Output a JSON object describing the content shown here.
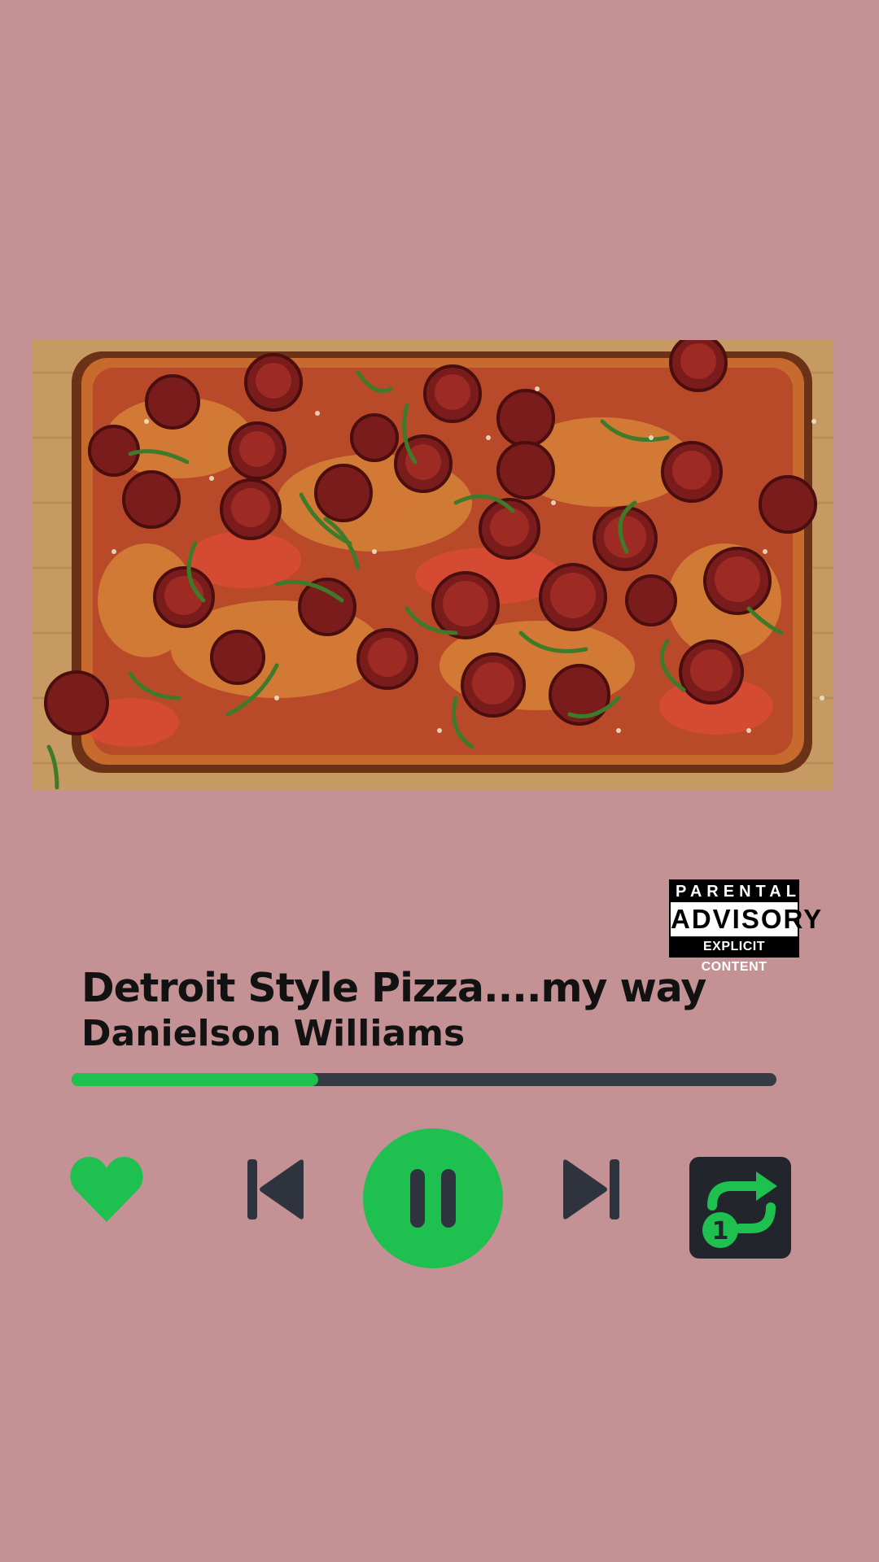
{
  "track": {
    "title": "Detroit Style Pizza....my way",
    "artist": "Danielson Williams",
    "progress_fraction": 0.35
  },
  "advisory": {
    "line1": "PARENTAL",
    "line2": "ADVISORY",
    "line3": "EXPLICIT CONTENT"
  },
  "album_art": {
    "subject": "detroit-style-pepperoni-pizza"
  },
  "controls": {
    "like_icon": "heart-icon",
    "prev_icon": "skip-previous-icon",
    "play_pause_icon": "pause-icon",
    "next_icon": "skip-next-icon",
    "repeat_icon": "repeat-one-icon",
    "repeat_badge": "1",
    "liked": true,
    "playing": true,
    "repeat_mode": "one"
  },
  "colors": {
    "background": "#c49294",
    "accent": "#1ec04f",
    "dark": "#2f333d",
    "track": "#363a43"
  }
}
